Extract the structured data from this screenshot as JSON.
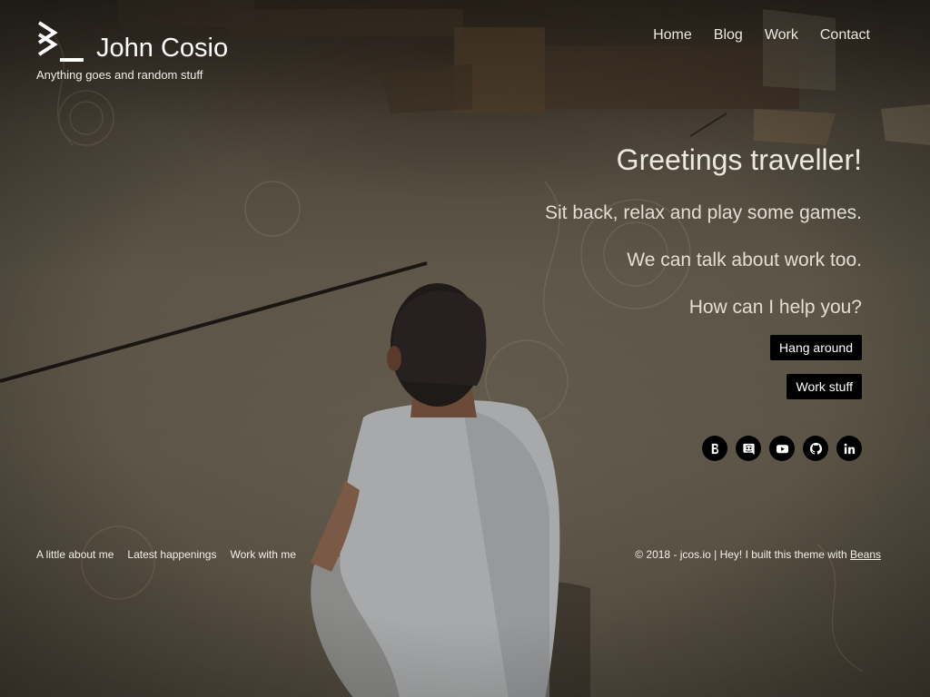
{
  "brand": {
    "name": "John Cosio",
    "tagline": "Anything goes and random stuff"
  },
  "nav": {
    "items": [
      "Home",
      "Blog",
      "Work",
      "Contact"
    ]
  },
  "hero": {
    "heading": "Greetings traveller!",
    "lines": [
      "Sit back, relax and play some games.",
      "We can talk about work too.",
      "How can I help you?"
    ],
    "buttons": [
      "Hang around",
      "Work stuff"
    ]
  },
  "socials": [
    {
      "icon": "behance-icon"
    },
    {
      "icon": "discord-icon"
    },
    {
      "icon": "youtube-icon"
    },
    {
      "icon": "github-icon"
    },
    {
      "icon": "linkedin-icon"
    }
  ],
  "footer": {
    "links": [
      "A little about me",
      "Latest happenings",
      "Work with me"
    ],
    "copyright_text": "© 2018 - jcos.io | Hey! I built this theme with ",
    "copyright_link": "Beans"
  },
  "colors": {
    "button_bg": "#000000",
    "text": "#ffffff"
  }
}
